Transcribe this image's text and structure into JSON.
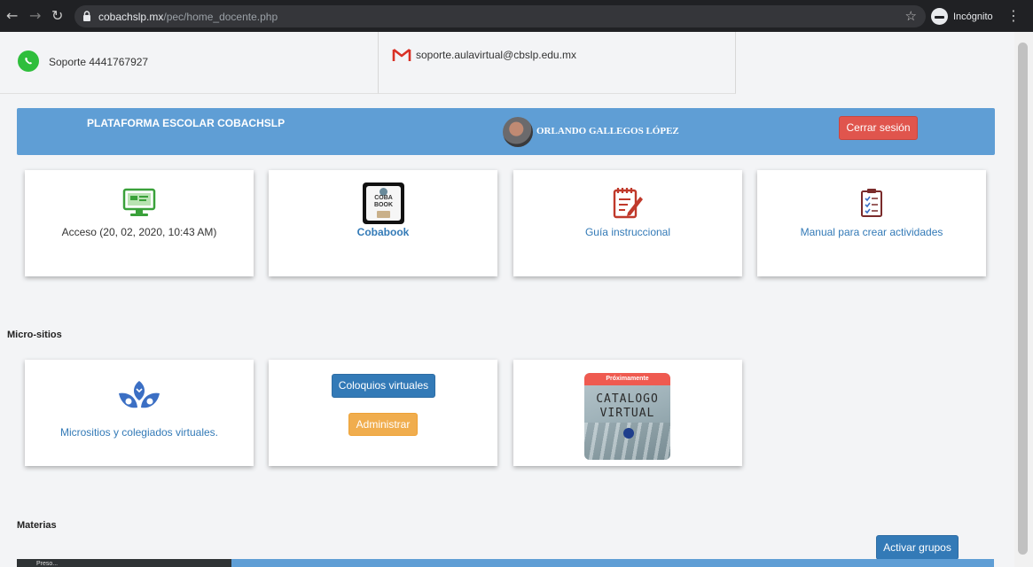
{
  "browser": {
    "back": "←",
    "forward": "→",
    "reload": "↻",
    "url_host": "cobachslp.mx",
    "url_path": "/pec/home_docente.php",
    "star": "☆",
    "incognito_label": "Incógnito",
    "menu": "⋮"
  },
  "support": {
    "phone": "Soporte 4441767927",
    "email": "soporte.aulavirtual@cbslp.edu.mx"
  },
  "header": {
    "brand": "PLATAFORMA ESCOLAR COBACHSLP",
    "user_name": "ORLANDO GALLEGOS LÓPEZ",
    "logout_label": "Cerrar sesión",
    "color": "#5f9ed5"
  },
  "cards": [
    {
      "label": "Acceso (20, 02, 2020, 10:43 AM)",
      "icon": "monitor-icon"
    },
    {
      "label": "Cobabook",
      "icon": "cobabook-logo",
      "logo_text": [
        "COBA",
        "BOOK"
      ]
    },
    {
      "label": "Guía instruccional",
      "icon": "notepad-pencil-icon"
    },
    {
      "label": "Manual para crear actividades",
      "icon": "clipboard-checklist-icon"
    }
  ],
  "micro": {
    "title": "Micro-sitios",
    "microsites_label": "Micrositios y colegiados virtuales.",
    "coloquios_label": "Coloquios virtuales",
    "admin_label": "Administrar",
    "catalog_badge": "Próximamente",
    "catalog_line1": "CATALOGO",
    "catalog_line2": "VIRTUAL"
  },
  "materias": {
    "title": "Materias",
    "activate_label": "Activar grupos",
    "bottom_label": "Preso..."
  },
  "colors": {
    "primary": "#337ab7",
    "danger": "#e0554d",
    "warning": "#f0ad4e",
    "whatsapp": "#2fbe3c"
  }
}
